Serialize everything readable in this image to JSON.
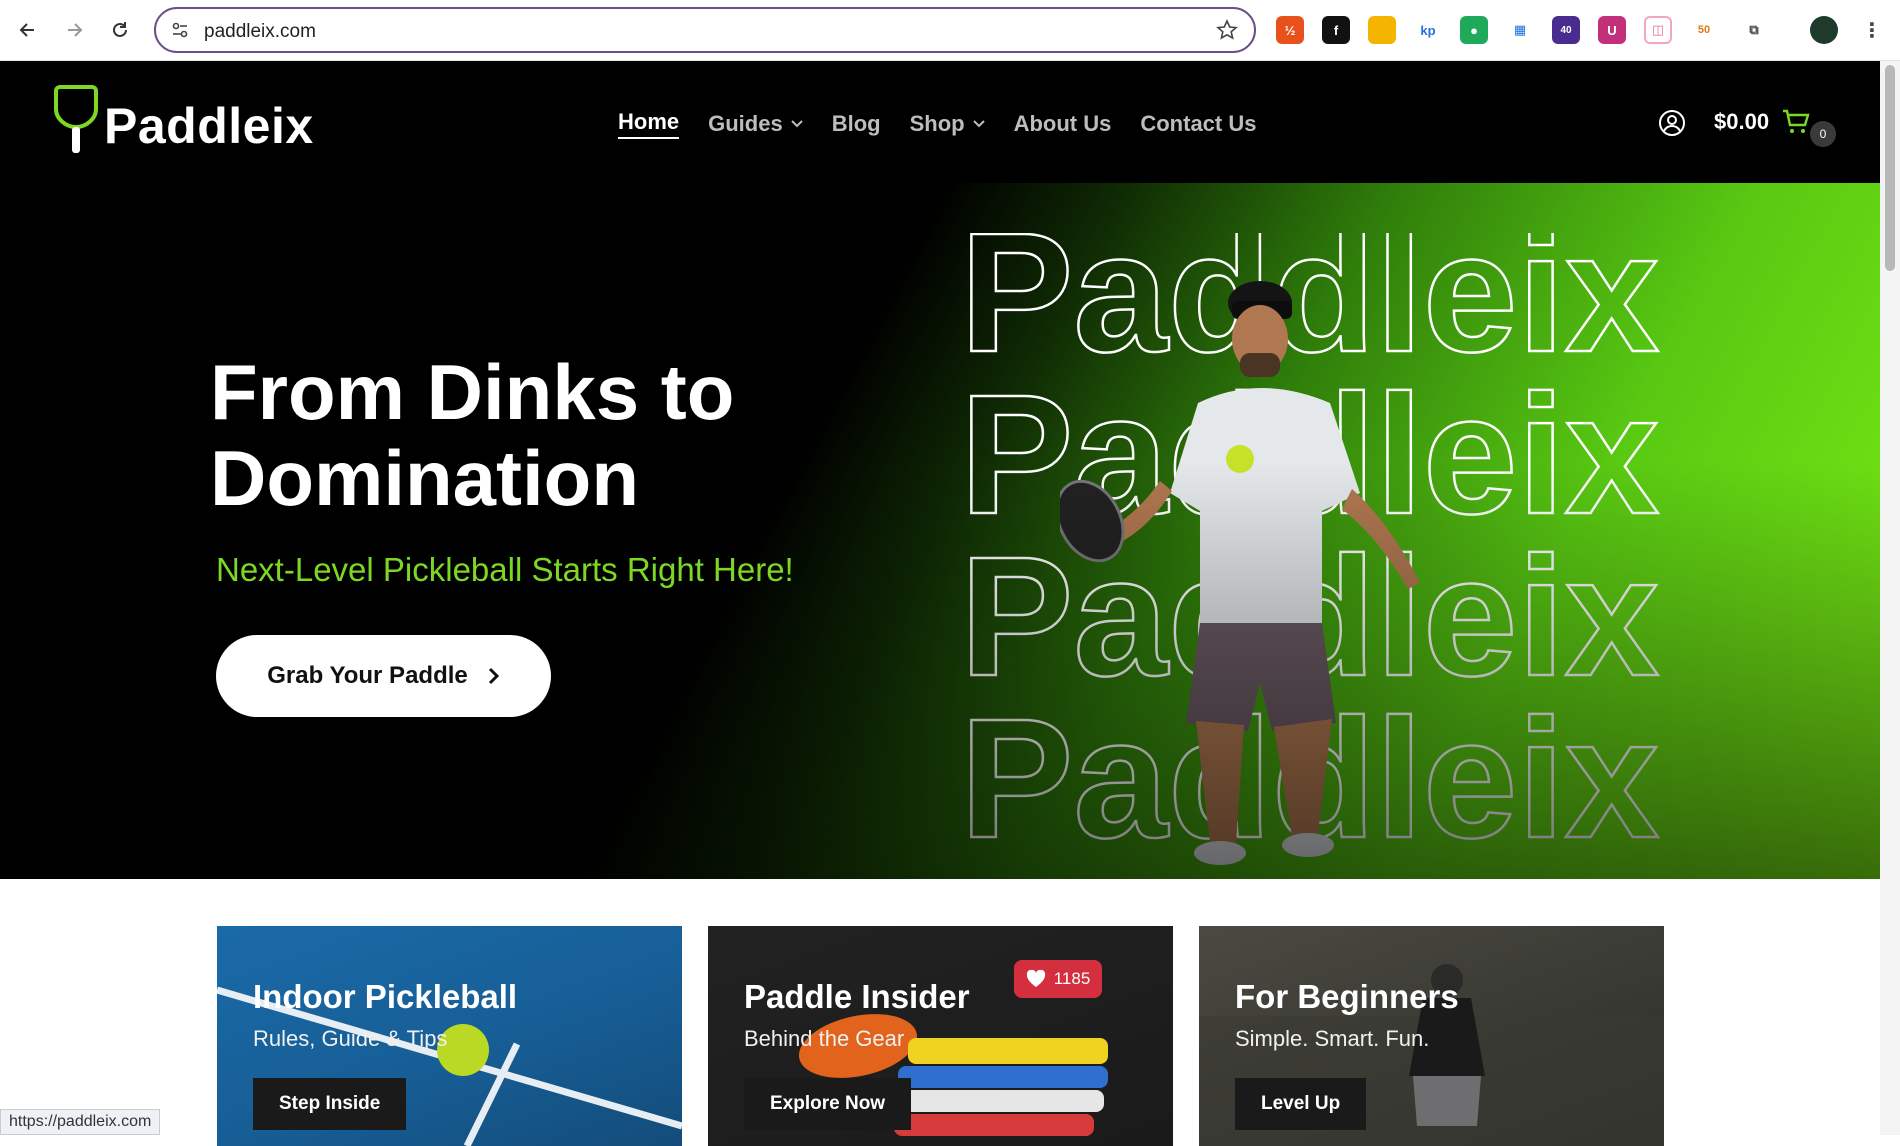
{
  "browser": {
    "url": "paddleix.com",
    "extension_badge": "40",
    "extension_badge_2": "50"
  },
  "site": {
    "brand": "Paddleix",
    "nav": [
      {
        "label": "Home"
      },
      {
        "label": "Guides"
      },
      {
        "label": "Blog"
      },
      {
        "label": "Shop"
      },
      {
        "label": "About Us"
      },
      {
        "label": "Contact Us"
      }
    ],
    "cart_total": "$0.00",
    "cart_count": "0"
  },
  "hero": {
    "title": "From Dinks to Domination",
    "subtitle": "Next-Level Pickleball Starts Right Here!",
    "cta_label": "Grab Your Paddle",
    "outline_word": "Paddleix"
  },
  "cards": [
    {
      "title": "Indoor Pickleball",
      "subtitle": "Rules, Guide & Tips",
      "button": "Step Inside"
    },
    {
      "title": "Paddle Insider",
      "subtitle": "Behind the Gear",
      "button": "Explore Now",
      "likes": "1185"
    },
    {
      "title": "For Beginners",
      "subtitle": "Simple. Smart. Fun.",
      "button": "Level Up"
    }
  ],
  "status_bar": {
    "url": "https://paddleix.com"
  },
  "colors": {
    "accent": "#7dd826",
    "header_bg": "#000000",
    "url_border": "#6b4e8a"
  }
}
